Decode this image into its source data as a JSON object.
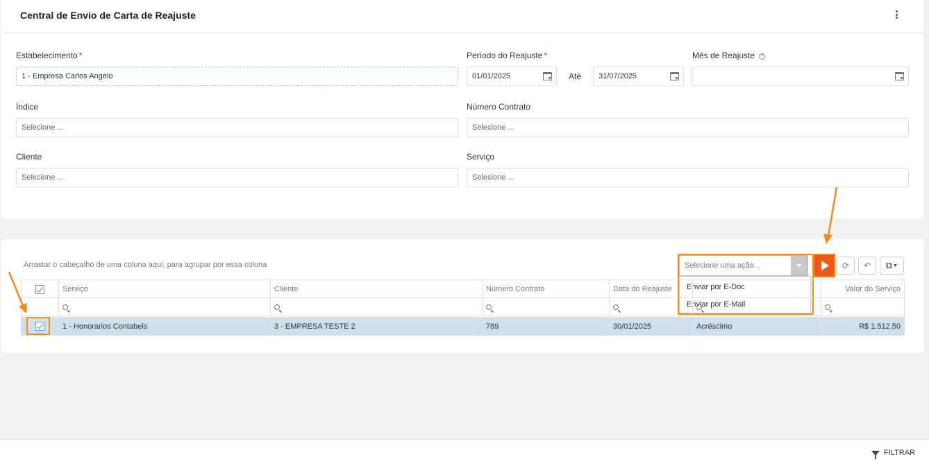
{
  "header": {
    "title": "Central de Envio de Carta de Reajuste"
  },
  "form": {
    "estabelecimento": {
      "label": "Estabelecimento",
      "value": "1 - Empresa Carlos Angelo"
    },
    "periodo": {
      "label": "Período do Reajuste",
      "from": "01/01/2025",
      "ate_label": "Até",
      "to": "31/07/2025"
    },
    "mes": {
      "label": "Mês de Reajuste",
      "value": ""
    },
    "indice": {
      "label": "Índice",
      "placeholder": "Selecione ..."
    },
    "numero_contrato": {
      "label": "Número Contrato",
      "placeholder": "Selecione ..."
    },
    "cliente": {
      "label": "Cliente",
      "placeholder": "Selecione ..."
    },
    "servico": {
      "label": "Serviço",
      "placeholder": "Selecione ..."
    },
    "required_mark": "*"
  },
  "grid": {
    "group_hint": "Arrastar o cabeçalho de uma coluna aqui, para agrupar por essa coluna",
    "action_placeholder": "Selecione uma ação...",
    "actions": [
      "Enviar por E-Doc",
      "Enviar por E-Mail"
    ],
    "columns": [
      "Serviço",
      "Cliente",
      "Número Contrato",
      "Data do Reajuste",
      "",
      "Valor do Serviço"
    ],
    "rows": [
      {
        "servico": "1 - Honorarios Contabeis",
        "cliente": "3 - EMPRESA TESTE 2",
        "numero_contrato": "789",
        "data_reajuste": "30/01/2025",
        "tipo": "Acréscimo",
        "valor": "R$ 1.512,50",
        "selected": true
      }
    ]
  },
  "footer": {
    "filter_label": "FILTRAR"
  },
  "colors": {
    "accent": "#ea5a1d",
    "highlight": "#f08c1f",
    "selected_row": "#cfdfeb"
  }
}
